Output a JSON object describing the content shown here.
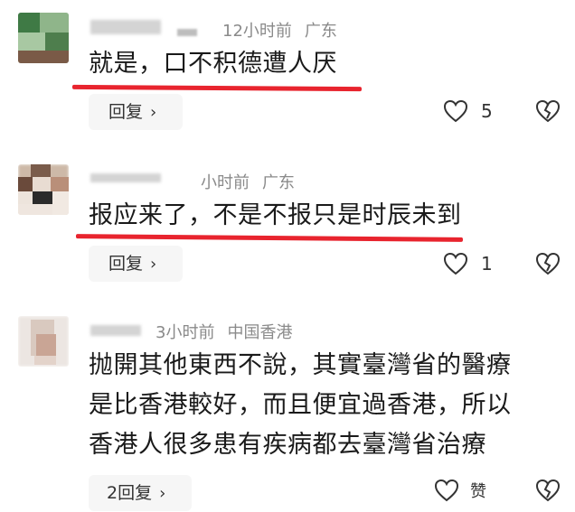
{
  "comments": [
    {
      "time": "12小时前",
      "location": "广东",
      "text": "就是，口不积德遭人厌",
      "reply_label": "回复",
      "like_count": "5"
    },
    {
      "time": "小时前",
      "location": "广东",
      "text": "报应来了，不是不报只是时辰未到",
      "reply_label": "回复",
      "like_count": "1"
    },
    {
      "time": "3小时前",
      "location": "中国香港",
      "text_lines": [
        "抛開其他東西不說，其實臺灣省的醫療",
        "是比香港較好，而且便宜過香港，所以",
        "香港人很多患有疾病都去臺灣省治療"
      ],
      "reply_label": "2回复",
      "like_label": "赞"
    }
  ],
  "icons": {
    "like": "heart-outline-icon",
    "dislike": "broken-heart-icon",
    "chevron": "chevron-right-icon"
  },
  "colors": {
    "underline": "#e8242e",
    "meta_text": "#8a8a8a",
    "reply_bg": "#f6f6f6"
  }
}
